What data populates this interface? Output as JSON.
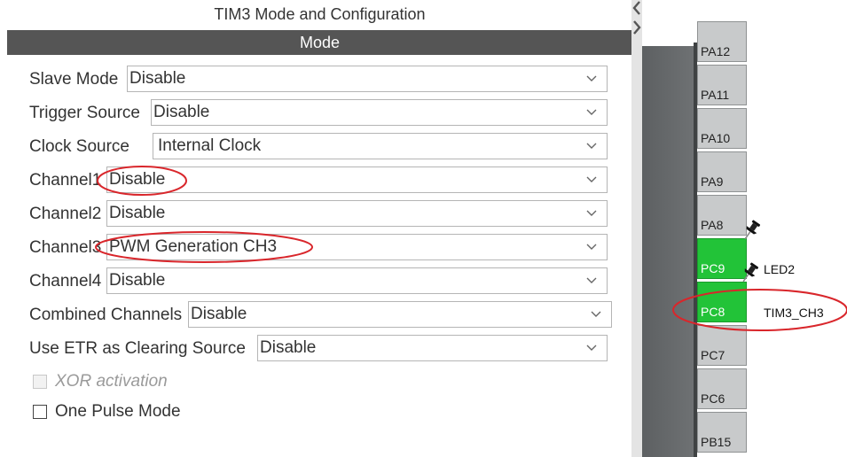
{
  "panel": {
    "title": "TIM3 Mode and Configuration",
    "section": "Mode"
  },
  "fields": {
    "slave_mode": {
      "label": "Slave Mode",
      "value": "Disable"
    },
    "trigger_source": {
      "label": "Trigger Source",
      "value": "Disable"
    },
    "clock_source": {
      "label": "Clock Source",
      "value": "Internal Clock"
    },
    "channel1": {
      "label": "Channel1",
      "value": "Disable"
    },
    "channel2": {
      "label": "Channel2",
      "value": "Disable"
    },
    "channel3": {
      "label": "Channel3",
      "value": "PWM Generation CH3"
    },
    "channel4": {
      "label": "Channel4",
      "value": "Disable"
    },
    "combined_channels": {
      "label": "Combined Channels",
      "value": "Disable"
    },
    "use_etr": {
      "label": "Use ETR as Clearing Source",
      "value": "Disable"
    }
  },
  "checkboxes": {
    "xor_activation": {
      "label": "XOR activation",
      "checked": false,
      "disabled": true
    },
    "one_pulse_mode": {
      "label": "One Pulse Mode",
      "checked": false,
      "disabled": false
    }
  },
  "chip": {
    "pins": [
      {
        "name": "PA12"
      },
      {
        "name": "PA11"
      },
      {
        "name": "PA10"
      },
      {
        "name": "PA9"
      },
      {
        "name": "PA8"
      },
      {
        "name": "PC9",
        "signal": "LED2",
        "assigned": true
      },
      {
        "name": "PC8",
        "signal": "TIM3_CH3",
        "assigned": true
      },
      {
        "name": "PC7"
      },
      {
        "name": "PC6"
      },
      {
        "name": "PB15"
      }
    ]
  },
  "colors": {
    "assigned_pin": "#22c338",
    "highlight_ring": "#d9262b",
    "mode_header": "#555555"
  }
}
